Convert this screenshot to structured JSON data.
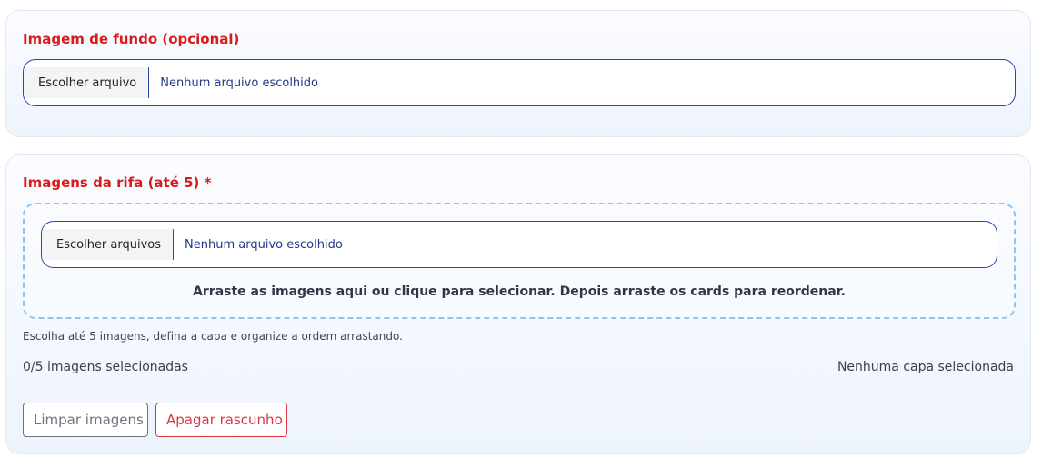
{
  "background_section": {
    "label": "Imagem de fundo (opcional)",
    "file_button_label": "Escolher arquivo",
    "file_status": "Nenhum arquivo escolhido"
  },
  "raffle_images_section": {
    "label": "Imagens da rifa (até 5) *",
    "file_button_label": "Escolher arquivos",
    "file_status": "Nenhum arquivo escolhido",
    "drop_hint": "Arraste as imagens aqui ou clique para selecionar. Depois arraste os cards para reordenar.",
    "help_text": "Escolha até 5 imagens, defina a capa e organize a ordem arrastando.",
    "count_text": "0/5 imagens selecionadas",
    "cover_text": "Nenhuma capa selecionada",
    "clear_button_label": "Limpar imagens",
    "delete_draft_button_label": "Apagar rascunho"
  },
  "colors": {
    "label_red": "#d81b1b",
    "input_border": "#2c47a8",
    "dropzone_border": "#8ec4ee",
    "danger": "#dc3545",
    "secondary": "#6b7280"
  }
}
